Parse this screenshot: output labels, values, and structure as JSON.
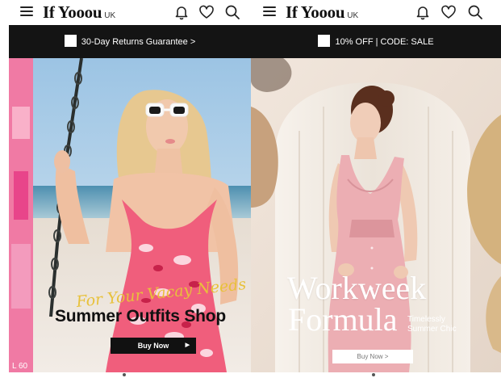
{
  "screens": [
    {
      "brand": "If Yooou",
      "region": "UK",
      "promo_text": "30-Day Returns Guarantee  >",
      "banner": {
        "script_line": "For Your Vacay Needs",
        "headline": "Summer Outfits Shop",
        "cta": "Buy Now",
        "cta_arrow": "▶",
        "corner_label": "L 60",
        "slides": 2,
        "active_slide": 1
      }
    },
    {
      "brand": "If Yooou",
      "region": "UK",
      "promo_text": "10% OFF | CODE: SALE",
      "banner": {
        "headline_line1": "Workweek",
        "headline_line2": "Formula",
        "tagline_line1": "Timelessly",
        "tagline_line2": "Summer Chic",
        "cta": "Buy Now  >",
        "slides": 2,
        "active_slide": 1
      }
    }
  ],
  "icons": [
    "menu-icon",
    "bell-icon",
    "heart-icon",
    "search-icon",
    "checkbox-icon"
  ],
  "colors": {
    "promo_bar": "#141414",
    "script_gold": "#e8c13a",
    "pink_backdrop": "#e8dcd2"
  }
}
